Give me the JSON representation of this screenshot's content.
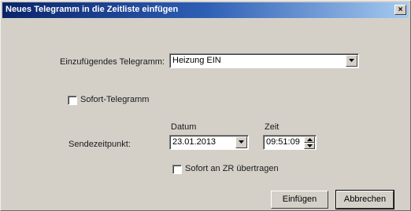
{
  "window": {
    "title": "Neues Telegramm in die Zeitliste einfügen",
    "close_glyph": "×"
  },
  "telegram": {
    "label": "Einzufügendes Telegramm:",
    "value": "Heizung EIN"
  },
  "sofort_telegramm": {
    "label": "Sofort-Telegramm",
    "checked": false
  },
  "sendezeitpunkt": {
    "label": "Sendezeitpunkt:",
    "datum_label": "Datum",
    "datum_value": "23.01.2013",
    "zeit_label": "Zeit",
    "zeit_value": "09:51:09"
  },
  "sofort_zr": {
    "label": "Sofort an ZR übertragen",
    "checked": false
  },
  "buttons": {
    "insert": "Einfügen",
    "cancel": "Abbrechen"
  },
  "colors": {
    "dialog_bg": "#d4d0c8",
    "titlebar_start": "#0a246a",
    "titlebar_end": "#a6caf0"
  }
}
